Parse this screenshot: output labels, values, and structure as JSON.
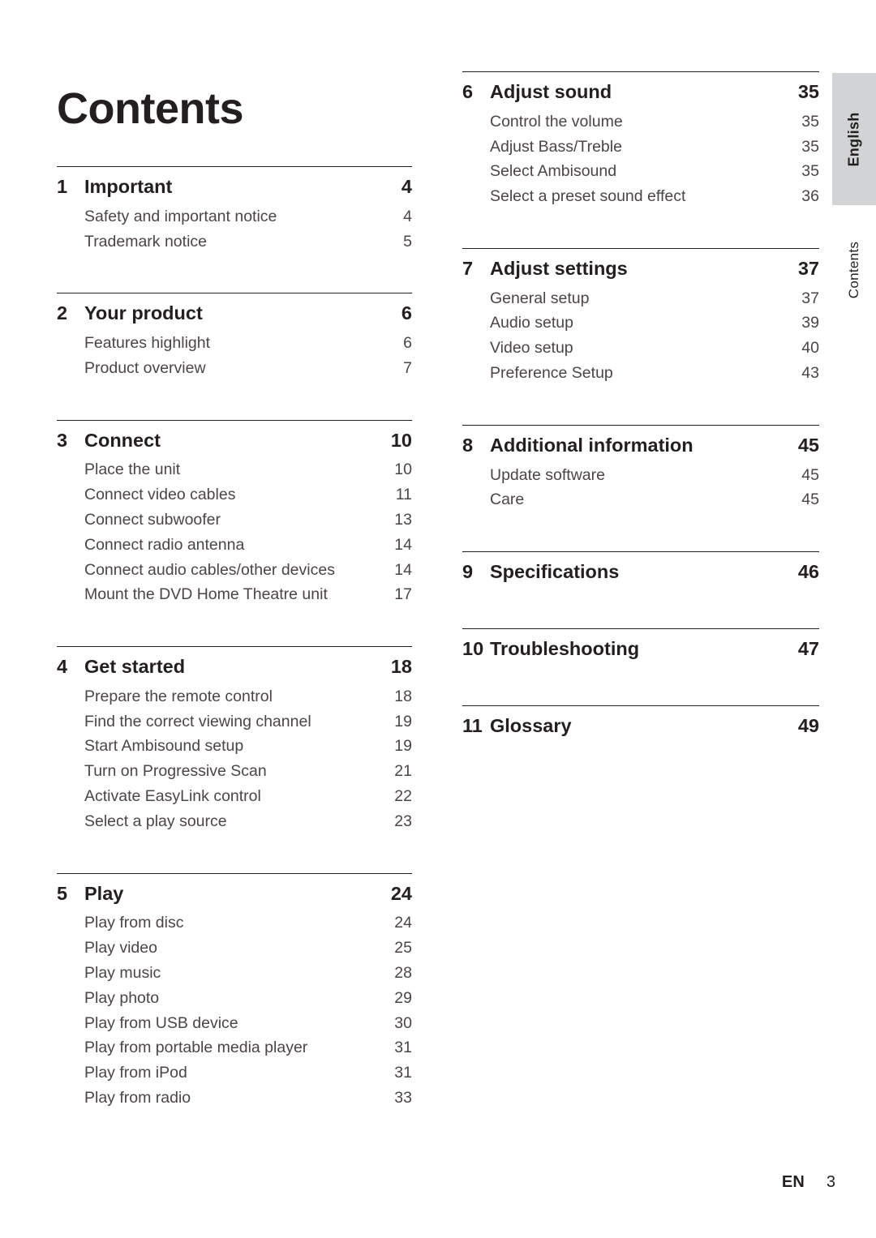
{
  "page": {
    "title": "Contents",
    "footer": {
      "language_code": "EN",
      "page_number": "3"
    },
    "sidebar": {
      "language_tab": "English",
      "chapter_tab": "Contents"
    }
  },
  "columns": {
    "left": [
      {
        "number": "1",
        "title": "Important",
        "page": "4",
        "entries": [
          {
            "label": "Safety and important notice",
            "page": "4"
          },
          {
            "label": "Trademark notice",
            "page": "5"
          }
        ]
      },
      {
        "number": "2",
        "title": "Your product",
        "page": "6",
        "entries": [
          {
            "label": "Features highlight",
            "page": "6"
          },
          {
            "label": "Product overview",
            "page": "7"
          }
        ]
      },
      {
        "number": "3",
        "title": "Connect",
        "page": "10",
        "entries": [
          {
            "label": "Place the unit",
            "page": "10"
          },
          {
            "label": "Connect video cables",
            "page": "11"
          },
          {
            "label": "Connect subwoofer",
            "page": "13"
          },
          {
            "label": "Connect radio antenna",
            "page": "14"
          },
          {
            "label": "Connect audio cables/other devices",
            "page": "14"
          },
          {
            "label": "Mount the DVD Home Theatre unit",
            "page": "17"
          }
        ]
      },
      {
        "number": "4",
        "title": "Get started",
        "page": "18",
        "entries": [
          {
            "label": "Prepare the remote control",
            "page": "18"
          },
          {
            "label": "Find the correct viewing channel",
            "page": "19"
          },
          {
            "label": "Start Ambisound setup",
            "page": "19"
          },
          {
            "label": "Turn on Progressive Scan",
            "page": "21"
          },
          {
            "label": "Activate EasyLink control",
            "page": "22"
          },
          {
            "label": "Select a play source",
            "page": "23"
          }
        ]
      },
      {
        "number": "5",
        "title": "Play",
        "page": "24",
        "entries": [
          {
            "label": "Play from disc",
            "page": "24"
          },
          {
            "label": "Play video",
            "page": "25"
          },
          {
            "label": "Play music",
            "page": "28"
          },
          {
            "label": "Play photo",
            "page": "29"
          },
          {
            "label": "Play from USB device",
            "page": "30"
          },
          {
            "label": "Play from portable media player",
            "page": "31"
          },
          {
            "label": "Play from iPod",
            "page": "31"
          },
          {
            "label": "Play from radio",
            "page": "33"
          }
        ]
      }
    ],
    "right": [
      {
        "number": "6",
        "title": "Adjust sound",
        "page": "35",
        "entries": [
          {
            "label": "Control the volume",
            "page": "35"
          },
          {
            "label": "Adjust Bass/Treble",
            "page": "35"
          },
          {
            "label": "Select Ambisound",
            "page": "35"
          },
          {
            "label": "Select a preset sound effect",
            "page": "36"
          }
        ]
      },
      {
        "number": "7",
        "title": "Adjust settings",
        "page": "37",
        "entries": [
          {
            "label": "General setup",
            "page": "37"
          },
          {
            "label": "Audio setup",
            "page": "39"
          },
          {
            "label": "Video setup",
            "page": "40"
          },
          {
            "label": "Preference Setup",
            "page": "43"
          }
        ]
      },
      {
        "number": "8",
        "title": "Additional information",
        "page": "45",
        "entries": [
          {
            "label": "Update software",
            "page": "45"
          },
          {
            "label": "Care",
            "page": "45"
          }
        ]
      },
      {
        "number": "9",
        "title": "Specifications",
        "page": "46",
        "entries": []
      },
      {
        "number": "10",
        "title": "Troubleshooting",
        "page": "47",
        "entries": []
      },
      {
        "number": "11",
        "title": "Glossary",
        "page": "49",
        "entries": []
      }
    ]
  }
}
